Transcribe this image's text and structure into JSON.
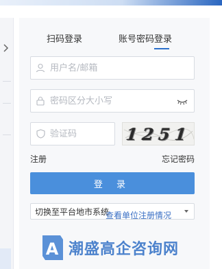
{
  "tabs": {
    "qr_label": "扫码登录",
    "account_label": "账号密码登录"
  },
  "form": {
    "username_placeholder": "用户名/邮箱",
    "password_placeholder": "密码区分大小写",
    "captcha_placeholder": "验证码",
    "captcha_text": "1251"
  },
  "links": {
    "register": "注册",
    "forgot": "忘记密码",
    "unit_register": "查看单位注册情况"
  },
  "login_button": "登 录",
  "platform_select": {
    "selected": "切换至平台地市系统"
  },
  "watermark": {
    "text": "潮盛高企咨询网",
    "logo_letter": "A"
  },
  "colors": {
    "accent": "#4a8fdc",
    "link_blue": "#3a6fc4",
    "panel_bg": "#f7f8fa"
  }
}
